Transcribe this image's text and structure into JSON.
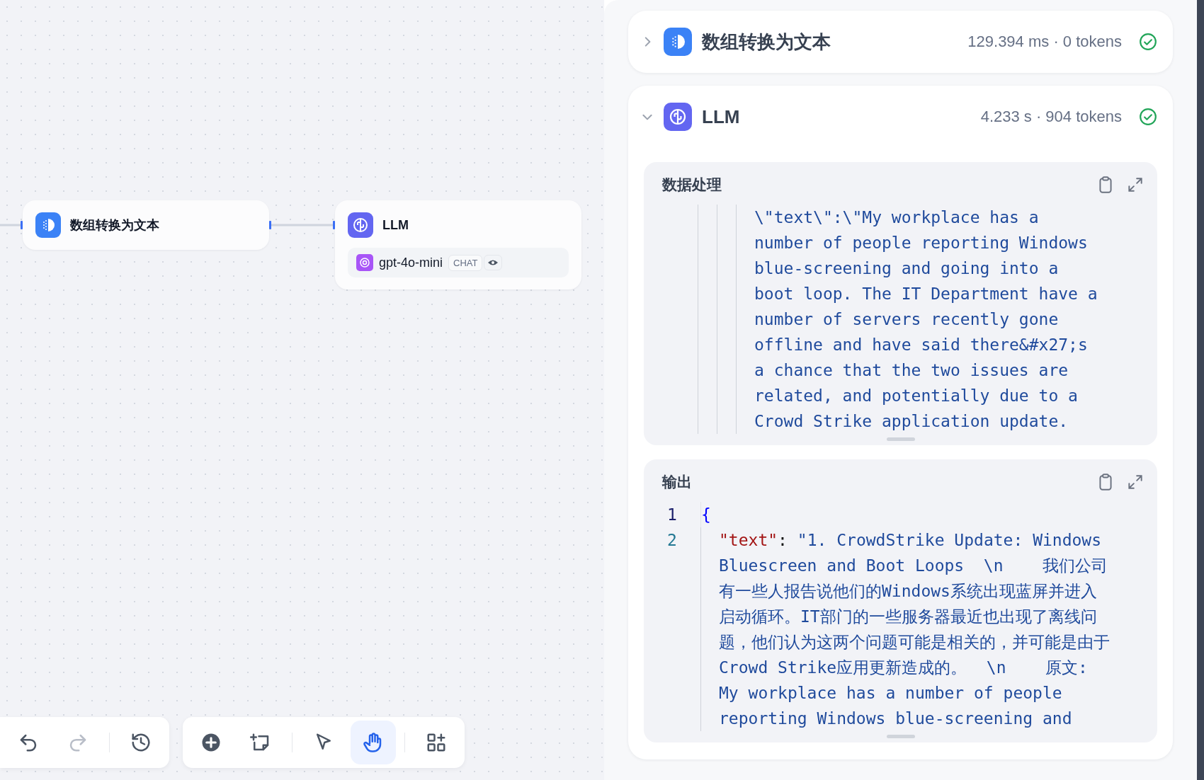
{
  "canvas": {
    "nodes": [
      {
        "kind": "transform",
        "title": "数组转换为文本"
      },
      {
        "kind": "llm",
        "title": "LLM",
        "model": {
          "name": "gpt-4o-mini",
          "mode": "CHAT"
        }
      }
    ],
    "toolbar": {
      "groups": [
        [
          {
            "kind": "undo",
            "disabled": false,
            "selected": false
          },
          {
            "kind": "redo",
            "disabled": true,
            "selected": false
          },
          {
            "kind": "history",
            "disabled": false,
            "selected": false
          }
        ],
        [
          {
            "kind": "add",
            "disabled": false,
            "selected": false
          },
          {
            "kind": "note",
            "disabled": false,
            "selected": false
          }
        ],
        [
          {
            "kind": "pointer",
            "disabled": false,
            "selected": false
          },
          {
            "kind": "hand",
            "disabled": false,
            "selected": true
          }
        ],
        [
          {
            "kind": "blocks",
            "disabled": false,
            "selected": false
          }
        ]
      ]
    }
  },
  "run_panel": {
    "steps": [
      {
        "kind": "transform",
        "title": "数组转换为文本",
        "stats": "129.394 ms · 0 tokens",
        "succeeded": true,
        "expanded": false
      },
      {
        "kind": "llm",
        "title": "LLM",
        "stats": "4.233 s · 904 tokens",
        "succeeded": true,
        "expanded": true,
        "sections": [
          {
            "title": "数据处理",
            "kind": "nested",
            "lines": [
              {
                "rows": [
                  [
                    {
                      "kind": "string",
                      "text": "\\\"text\\\":\\\"My workplace has a"
                    }
                  ],
                  [
                    {
                      "kind": "string",
                      "text": "number of people reporting Windows"
                    }
                  ],
                  [
                    {
                      "kind": "string",
                      "text": "blue-screening and going into a"
                    }
                  ],
                  [
                    {
                      "kind": "string",
                      "text": "boot loop. The IT Department have a"
                    }
                  ],
                  [
                    {
                      "kind": "string",
                      "text": "number of servers recently gone"
                    }
                  ],
                  [
                    {
                      "kind": "string",
                      "text": "offline and have said there&#x27;s"
                    }
                  ],
                  [
                    {
                      "kind": "string",
                      "text": "a chance that the two issues are"
                    }
                  ],
                  [
                    {
                      "kind": "string",
                      "text": "related, and potentially due to a"
                    }
                  ],
                  [
                    {
                      "kind": "string",
                      "text": "Crowd Strike application update."
                    }
                  ]
                ]
              }
            ]
          },
          {
            "title": "输出",
            "kind": "numbered",
            "lines": [
              {
                "number": "1",
                "rows": [
                  [
                    {
                      "kind": "brace",
                      "text": "{"
                    }
                  ]
                ]
              },
              {
                "number": "2",
                "rows": [
                  [
                    {
                      "kind": "key",
                      "text": "\"text\""
                    },
                    {
                      "kind": "punct",
                      "text": ": "
                    },
                    {
                      "kind": "string",
                      "text": "\"1. CrowdStrike Update: Windows"
                    }
                  ],
                  [
                    {
                      "kind": "string",
                      "text": "Bluescreen and Boot Loops  \\n    我们公司"
                    }
                  ],
                  [
                    {
                      "kind": "string",
                      "text": "有一些人报告说他们的Windows系统出现蓝屏并进入"
                    }
                  ],
                  [
                    {
                      "kind": "string",
                      "text": "启动循环。IT部门的一些服务器最近也出现了离线问"
                    }
                  ],
                  [
                    {
                      "kind": "string",
                      "text": "题，他们认为这两个问题可能是相关的，并可能是由于"
                    }
                  ],
                  [
                    {
                      "kind": "string",
                      "text": "Crowd Strike应用更新造成的。  \\n    原文:"
                    }
                  ],
                  [
                    {
                      "kind": "string",
                      "text": "My workplace has a number of people"
                    }
                  ],
                  [
                    {
                      "kind": "string",
                      "text": "reporting Windows blue-screening and"
                    }
                  ]
                ]
              }
            ]
          }
        ]
      }
    ]
  }
}
